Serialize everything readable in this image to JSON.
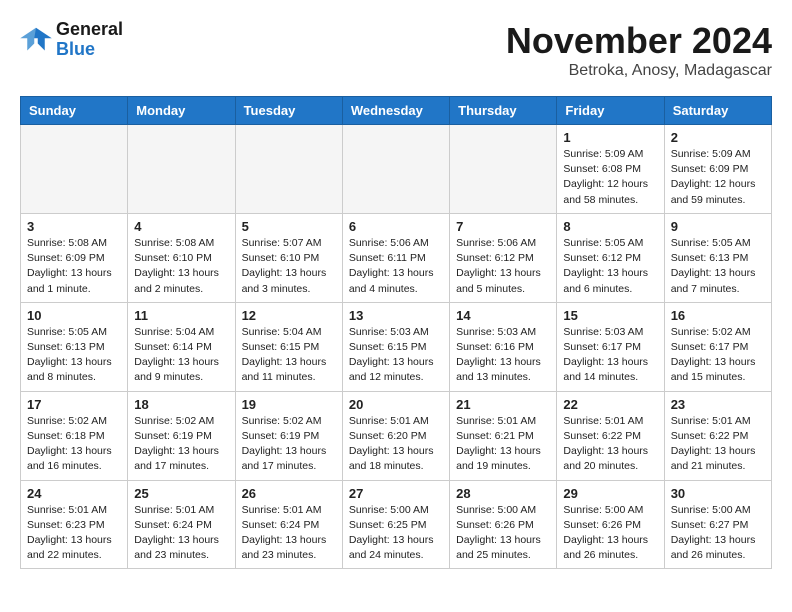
{
  "header": {
    "logo_line1": "General",
    "logo_line2": "Blue",
    "month": "November 2024",
    "location": "Betroka, Anosy, Madagascar"
  },
  "weekdays": [
    "Sunday",
    "Monday",
    "Tuesday",
    "Wednesday",
    "Thursday",
    "Friday",
    "Saturday"
  ],
  "weeks": [
    [
      {
        "day": "",
        "info": ""
      },
      {
        "day": "",
        "info": ""
      },
      {
        "day": "",
        "info": ""
      },
      {
        "day": "",
        "info": ""
      },
      {
        "day": "",
        "info": ""
      },
      {
        "day": "1",
        "info": "Sunrise: 5:09 AM\nSunset: 6:08 PM\nDaylight: 12 hours\nand 58 minutes."
      },
      {
        "day": "2",
        "info": "Sunrise: 5:09 AM\nSunset: 6:09 PM\nDaylight: 12 hours\nand 59 minutes."
      }
    ],
    [
      {
        "day": "3",
        "info": "Sunrise: 5:08 AM\nSunset: 6:09 PM\nDaylight: 13 hours\nand 1 minute."
      },
      {
        "day": "4",
        "info": "Sunrise: 5:08 AM\nSunset: 6:10 PM\nDaylight: 13 hours\nand 2 minutes."
      },
      {
        "day": "5",
        "info": "Sunrise: 5:07 AM\nSunset: 6:10 PM\nDaylight: 13 hours\nand 3 minutes."
      },
      {
        "day": "6",
        "info": "Sunrise: 5:06 AM\nSunset: 6:11 PM\nDaylight: 13 hours\nand 4 minutes."
      },
      {
        "day": "7",
        "info": "Sunrise: 5:06 AM\nSunset: 6:12 PM\nDaylight: 13 hours\nand 5 minutes."
      },
      {
        "day": "8",
        "info": "Sunrise: 5:05 AM\nSunset: 6:12 PM\nDaylight: 13 hours\nand 6 minutes."
      },
      {
        "day": "9",
        "info": "Sunrise: 5:05 AM\nSunset: 6:13 PM\nDaylight: 13 hours\nand 7 minutes."
      }
    ],
    [
      {
        "day": "10",
        "info": "Sunrise: 5:05 AM\nSunset: 6:13 PM\nDaylight: 13 hours\nand 8 minutes."
      },
      {
        "day": "11",
        "info": "Sunrise: 5:04 AM\nSunset: 6:14 PM\nDaylight: 13 hours\nand 9 minutes."
      },
      {
        "day": "12",
        "info": "Sunrise: 5:04 AM\nSunset: 6:15 PM\nDaylight: 13 hours\nand 11 minutes."
      },
      {
        "day": "13",
        "info": "Sunrise: 5:03 AM\nSunset: 6:15 PM\nDaylight: 13 hours\nand 12 minutes."
      },
      {
        "day": "14",
        "info": "Sunrise: 5:03 AM\nSunset: 6:16 PM\nDaylight: 13 hours\nand 13 minutes."
      },
      {
        "day": "15",
        "info": "Sunrise: 5:03 AM\nSunset: 6:17 PM\nDaylight: 13 hours\nand 14 minutes."
      },
      {
        "day": "16",
        "info": "Sunrise: 5:02 AM\nSunset: 6:17 PM\nDaylight: 13 hours\nand 15 minutes."
      }
    ],
    [
      {
        "day": "17",
        "info": "Sunrise: 5:02 AM\nSunset: 6:18 PM\nDaylight: 13 hours\nand 16 minutes."
      },
      {
        "day": "18",
        "info": "Sunrise: 5:02 AM\nSunset: 6:19 PM\nDaylight: 13 hours\nand 17 minutes."
      },
      {
        "day": "19",
        "info": "Sunrise: 5:02 AM\nSunset: 6:19 PM\nDaylight: 13 hours\nand 17 minutes."
      },
      {
        "day": "20",
        "info": "Sunrise: 5:01 AM\nSunset: 6:20 PM\nDaylight: 13 hours\nand 18 minutes."
      },
      {
        "day": "21",
        "info": "Sunrise: 5:01 AM\nSunset: 6:21 PM\nDaylight: 13 hours\nand 19 minutes."
      },
      {
        "day": "22",
        "info": "Sunrise: 5:01 AM\nSunset: 6:22 PM\nDaylight: 13 hours\nand 20 minutes."
      },
      {
        "day": "23",
        "info": "Sunrise: 5:01 AM\nSunset: 6:22 PM\nDaylight: 13 hours\nand 21 minutes."
      }
    ],
    [
      {
        "day": "24",
        "info": "Sunrise: 5:01 AM\nSunset: 6:23 PM\nDaylight: 13 hours\nand 22 minutes."
      },
      {
        "day": "25",
        "info": "Sunrise: 5:01 AM\nSunset: 6:24 PM\nDaylight: 13 hours\nand 23 minutes."
      },
      {
        "day": "26",
        "info": "Sunrise: 5:01 AM\nSunset: 6:24 PM\nDaylight: 13 hours\nand 23 minutes."
      },
      {
        "day": "27",
        "info": "Sunrise: 5:00 AM\nSunset: 6:25 PM\nDaylight: 13 hours\nand 24 minutes."
      },
      {
        "day": "28",
        "info": "Sunrise: 5:00 AM\nSunset: 6:26 PM\nDaylight: 13 hours\nand 25 minutes."
      },
      {
        "day": "29",
        "info": "Sunrise: 5:00 AM\nSunset: 6:26 PM\nDaylight: 13 hours\nand 26 minutes."
      },
      {
        "day": "30",
        "info": "Sunrise: 5:00 AM\nSunset: 6:27 PM\nDaylight: 13 hours\nand 26 minutes."
      }
    ]
  ]
}
